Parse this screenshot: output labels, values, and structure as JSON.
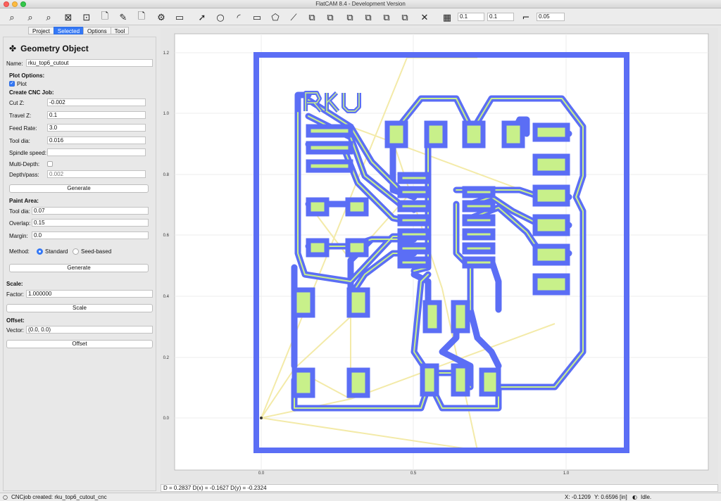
{
  "window": {
    "title": "FlatCAM 8.4 - Development Version"
  },
  "toolbar": {
    "icons": [
      "zoom-fit-icon",
      "zoom-in-icon",
      "zoom-out-icon",
      "clear-plot-icon",
      "replot-icon",
      "new-geometry-icon",
      "edit-geometry-icon",
      "delete-icon",
      "shell-icon",
      "select-icon",
      "circle-icon",
      "arc-icon",
      "rectangle-icon",
      "polygon-icon",
      "path-icon",
      "union-icon",
      "intersection-icon",
      "subtract-icon",
      "cut-icon",
      "copy-icon",
      "move-icon",
      "delete-shape-icon",
      "snap-grid-icon",
      "snap-corner-icon"
    ],
    "grid_x": "0.1",
    "grid_y": "0.1",
    "snap_max": "0.05"
  },
  "tabs": [
    {
      "label": "Project",
      "active": false
    },
    {
      "label": "Selected",
      "active": true
    },
    {
      "label": "Options",
      "active": false
    },
    {
      "label": "Tool",
      "active": false
    }
  ],
  "panel": {
    "title": "Geometry Object",
    "name_label": "Name:",
    "name_value": "rku_top6_cutout",
    "plot_options_label": "Plot Options:",
    "plot_label": "Plot",
    "cnc_label": "Create CNC Job:",
    "cut_z_label": "Cut Z:",
    "cut_z": "-0.002",
    "travel_z_label": "Travel Z:",
    "travel_z": "0.1",
    "feed_rate_label": "Feed Rate:",
    "feed_rate": "3.0",
    "tool_dia_label": "Tool dia:",
    "tool_dia": "0.016",
    "spindle_label": "Spindle speed:",
    "spindle": "",
    "multi_depth_label": "Multi-Depth:",
    "depth_pass_label": "Depth/pass:",
    "depth_pass": "0.002",
    "generate_label": "Generate",
    "paint_label": "Paint Area:",
    "paint_tool_dia_label": "Tool dia:",
    "paint_tool_dia": "0.07",
    "overlap_label": "Overlap:",
    "overlap": "0.15",
    "margin_label": "Margin:",
    "margin": "0.0",
    "method_label": "Method:",
    "method_standard": "Standard",
    "method_seed": "Seed-based",
    "paint_generate_label": "Generate",
    "scale_label": "Scale:",
    "factor_label": "Factor:",
    "factor": "1.000000",
    "scale_button": "Scale",
    "offset_label": "Offset:",
    "vector_label": "Vector:",
    "vector": "(0.0, 0.0)",
    "offset_button": "Offset"
  },
  "plot": {
    "y_ticks": [
      "1.2",
      "1.0",
      "0.8",
      "0.6",
      "0.4",
      "0.2",
      "0.0"
    ],
    "x_ticks": [
      "0.0",
      "0.5",
      "1.0"
    ],
    "colors": {
      "trace": "#5b6ef5",
      "pad": "#c8f08a",
      "travel": "#f2e79a"
    }
  },
  "distance_line": "D = 0.2837  D(x) = -0.1627  D(y) = -0.2324",
  "status": {
    "message": "CNCjob created: rku_top6_cutout_cnc",
    "x_label": "X: -0.1209",
    "y_label": "Y: 0.6596",
    "units": "[in]",
    "state": "Idle."
  }
}
